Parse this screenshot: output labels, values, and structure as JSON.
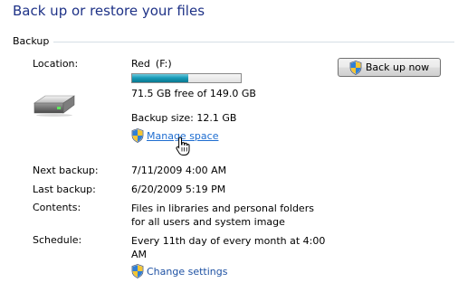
{
  "header": {
    "title": "Back up or restore your files"
  },
  "backup": {
    "section_label": "Backup",
    "location_label": "Location:",
    "drive_name": "Red",
    "drive_letter": "(F:)",
    "free_space": "71.5 GB free of 149.0 GB",
    "used_fraction": 0.52,
    "backup_size": "Backup size: 12.1 GB",
    "manage_space_link": "Manage space",
    "backup_now_button": "Back up now",
    "next_backup_label": "Next backup:",
    "next_backup_value": "7/11/2009 4:00 AM",
    "last_backup_label": "Last backup:",
    "last_backup_value": "6/20/2009 5:19 PM",
    "contents_label": "Contents:",
    "contents_value": "Files in libraries and personal folders for all users and system image",
    "schedule_label": "Schedule:",
    "schedule_value": "Every 11th day of every month at 4:00 AM",
    "change_settings_link": "Change settings"
  },
  "icons": {
    "drive": "drive-icon",
    "shield": "uac-shield-icon",
    "cursor": "hand-cursor-icon"
  },
  "colors": {
    "title": "#1e3287",
    "link": "#1e51a3",
    "capacity_fill": "#1a9bb9"
  }
}
